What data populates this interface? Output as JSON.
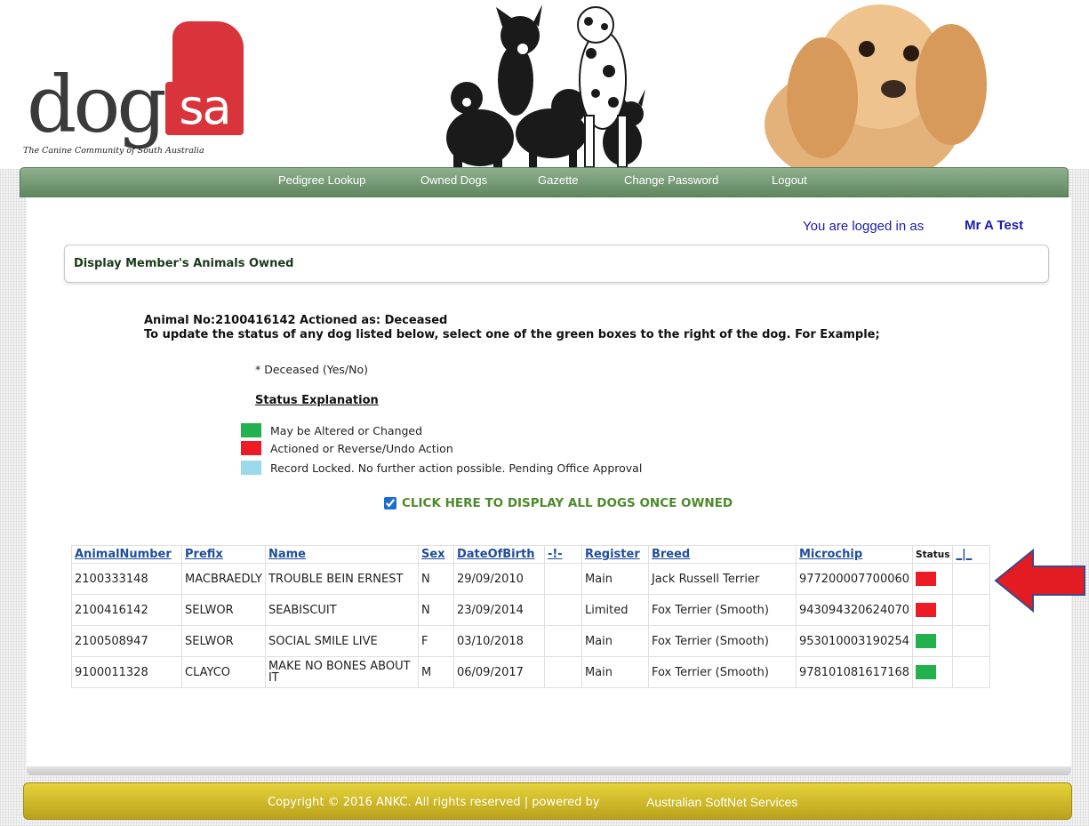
{
  "header": {
    "logo_text": "dogs",
    "logo_badge": "sa",
    "tagline": "The Canine Community of South Australia"
  },
  "nav": {
    "items": [
      {
        "label": "Pedigree Lookup"
      },
      {
        "label": "Owned Dogs"
      },
      {
        "label": "Gazette"
      },
      {
        "label": "Change Password"
      },
      {
        "label": "Logout"
      }
    ]
  },
  "login": {
    "label": "You are logged in as",
    "user": "Mr A Test"
  },
  "section": {
    "title": "Display Member's Animals Owned"
  },
  "message": {
    "line1": "Animal No:2100416142 Actioned as: Deceased",
    "line2": "To update the status of any dog listed below, select one of the green boxes to the right of the dog. For Example;",
    "example": "* Deceased (Yes/No)"
  },
  "legend": {
    "title": "Status Explanation",
    "items": [
      {
        "label": "May be Altered or Changed",
        "color": "#22b14c"
      },
      {
        "label": "Actioned or Reverse/Undo Action",
        "color": "#ed1c24"
      },
      {
        "label": "Record Locked. No further action possible. Pending Office Approval",
        "color": "#99d9ea"
      }
    ]
  },
  "display_all": {
    "checked": true,
    "label": "CLICK HERE TO DISPLAY ALL DOGS ONCE OWNED"
  },
  "table": {
    "headers": [
      "AnimalNumber",
      "Prefix",
      "Name",
      "Sex",
      "DateOfBirth",
      "-!-",
      "Register",
      "Breed",
      "Microchip",
      "Status",
      "_|_"
    ],
    "rows": [
      {
        "animal_number": "2100333148",
        "prefix": "MACBRAEDLY",
        "name": "TROUBLE BEIN ERNEST",
        "sex": "N",
        "dob": "29/09/2010",
        "flag": "",
        "register": "Main",
        "breed": "Jack Russell Terrier",
        "microchip": "977200007700060",
        "status_color": "#ed1c24",
        "extra": ""
      },
      {
        "animal_number": "2100416142",
        "prefix": "SELWOR",
        "name": "SEABISCUIT",
        "sex": "N",
        "dob": "23/09/2014",
        "flag": "",
        "register": "Limited",
        "breed": "Fox Terrier (Smooth)",
        "microchip": "943094320624070",
        "status_color": "#ed1c24",
        "extra": ""
      },
      {
        "animal_number": "2100508947",
        "prefix": "SELWOR",
        "name": "SOCIAL SMILE LIVE",
        "sex": "F",
        "dob": "03/10/2018",
        "flag": "",
        "register": "Main",
        "breed": "Fox Terrier (Smooth)",
        "microchip": "953010003190254",
        "status_color": "#22b14c",
        "extra": ""
      },
      {
        "animal_number": "9100011328",
        "prefix": "CLAYCO",
        "name": "MAKE NO BONES ABOUT IT",
        "sex": "M",
        "dob": "06/09/2017",
        "flag": "",
        "register": "Main",
        "breed": "Fox Terrier (Smooth)",
        "microchip": "978101081617168",
        "status_color": "#22b14c",
        "extra": ""
      }
    ]
  },
  "footer": {
    "text": "Copyright © 2016 ANKC. All rights reserved | powered by",
    "link": "Australian SoftNet Services"
  },
  "colors": {
    "nav_green": "#6e936e",
    "footer_gold": "#d4bf2c",
    "link_blue": "#1f4e9a",
    "arrow_red": "#e31b23"
  }
}
